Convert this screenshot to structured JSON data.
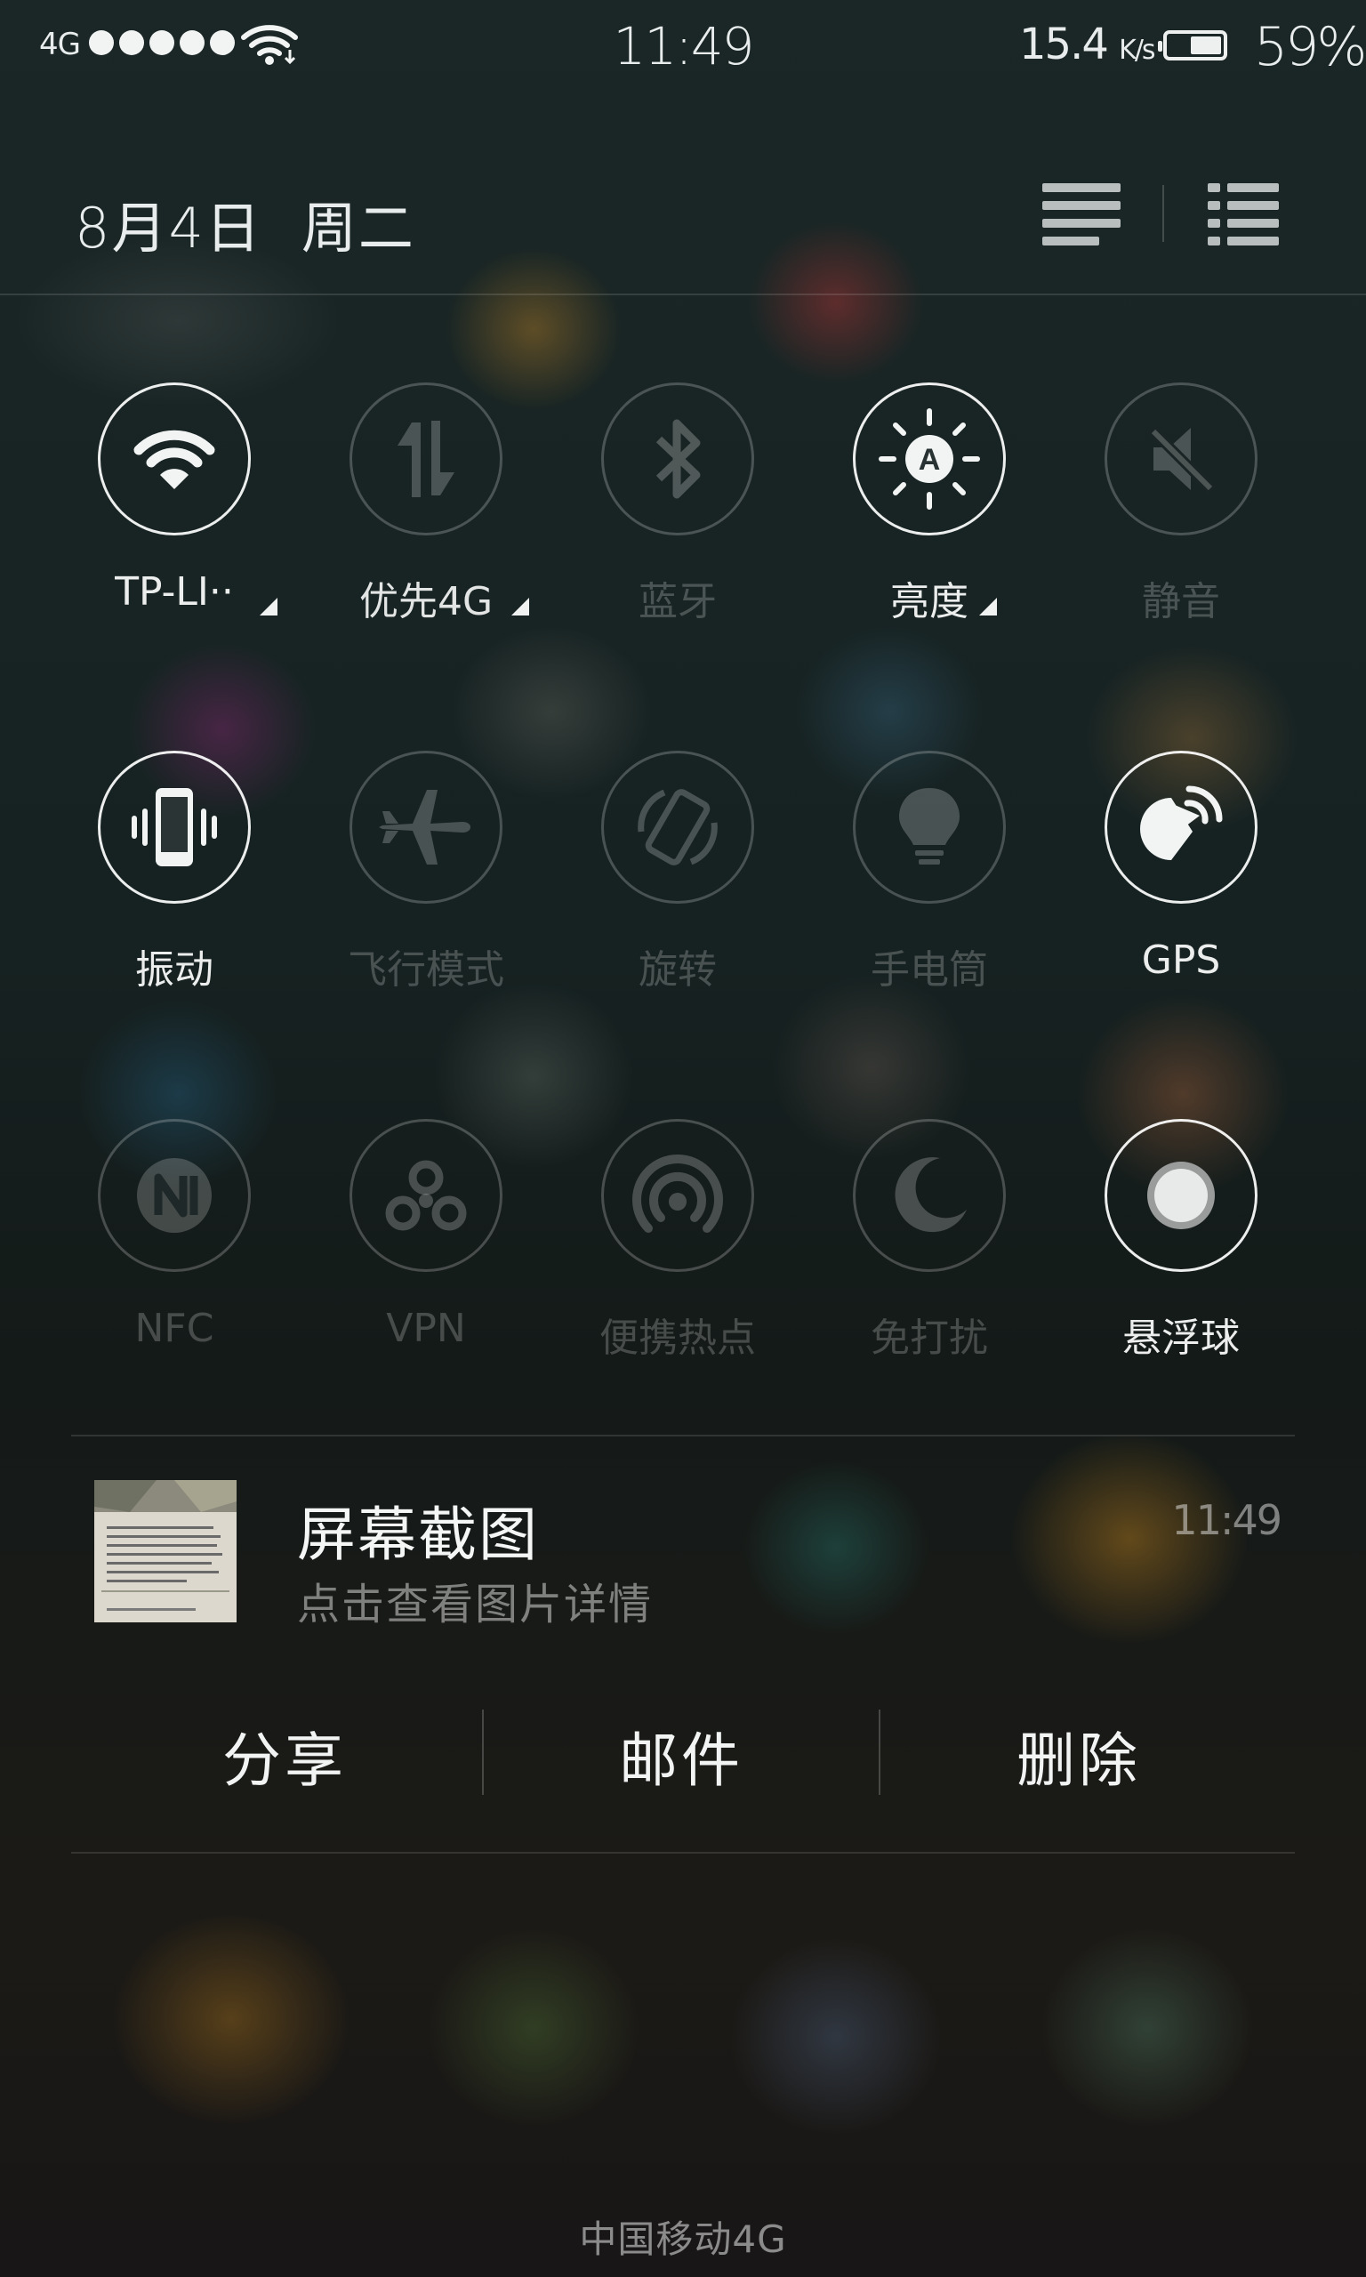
{
  "status_bar": {
    "network_type": "4G",
    "signal_bars": 5,
    "time": "11:49",
    "net_speed": "15.4",
    "net_speed_unit": "K/s",
    "battery_level": 0.59,
    "battery_percent": "59%"
  },
  "header": {
    "date": "8月4日",
    "weekday": "周二",
    "icons": [
      "notification-list-icon",
      "toggle-list-icon"
    ]
  },
  "toggles": [
    {
      "label": "TP-LI··",
      "icon": "wifi-icon",
      "on": true,
      "has_menu": true
    },
    {
      "label": "优先4G",
      "icon": "mobile-data-icon",
      "on": false,
      "has_menu": true
    },
    {
      "label": "蓝牙",
      "icon": "bluetooth-icon",
      "on": false,
      "has_menu": false
    },
    {
      "label": "亮度",
      "icon": "auto-brightness-icon",
      "on": true,
      "has_menu": true
    },
    {
      "label": "静音",
      "icon": "mute-icon",
      "on": false,
      "has_menu": false
    },
    {
      "label": "振动",
      "icon": "vibrate-icon",
      "on": true,
      "has_menu": false
    },
    {
      "label": "飞行模式",
      "icon": "airplane-icon",
      "on": false,
      "has_menu": false
    },
    {
      "label": "旋转",
      "icon": "rotate-icon",
      "on": false,
      "has_menu": false
    },
    {
      "label": "手电筒",
      "icon": "flashlight-icon",
      "on": false,
      "has_menu": false
    },
    {
      "label": "GPS",
      "icon": "gps-icon",
      "on": true,
      "has_menu": false
    },
    {
      "label": "NFC",
      "icon": "nfc-icon",
      "on": false,
      "has_menu": false
    },
    {
      "label": "VPN",
      "icon": "vpn-icon",
      "on": false,
      "has_menu": false
    },
    {
      "label": "便携热点",
      "icon": "hotspot-icon",
      "on": false,
      "has_menu": false
    },
    {
      "label": "免打扰",
      "icon": "moon-icon",
      "on": false,
      "has_menu": false
    },
    {
      "label": "悬浮球",
      "icon": "floating-ball-icon",
      "on": true,
      "has_menu": false
    }
  ],
  "notification": {
    "title": "屏幕截图",
    "subtitle": "点击查看图片详情",
    "time": "11:49",
    "actions": [
      "分享",
      "邮件",
      "删除"
    ]
  },
  "carrier": "中国移动4G",
  "colors": {
    "on": "#f0f2f2",
    "off": "#5a6464"
  }
}
